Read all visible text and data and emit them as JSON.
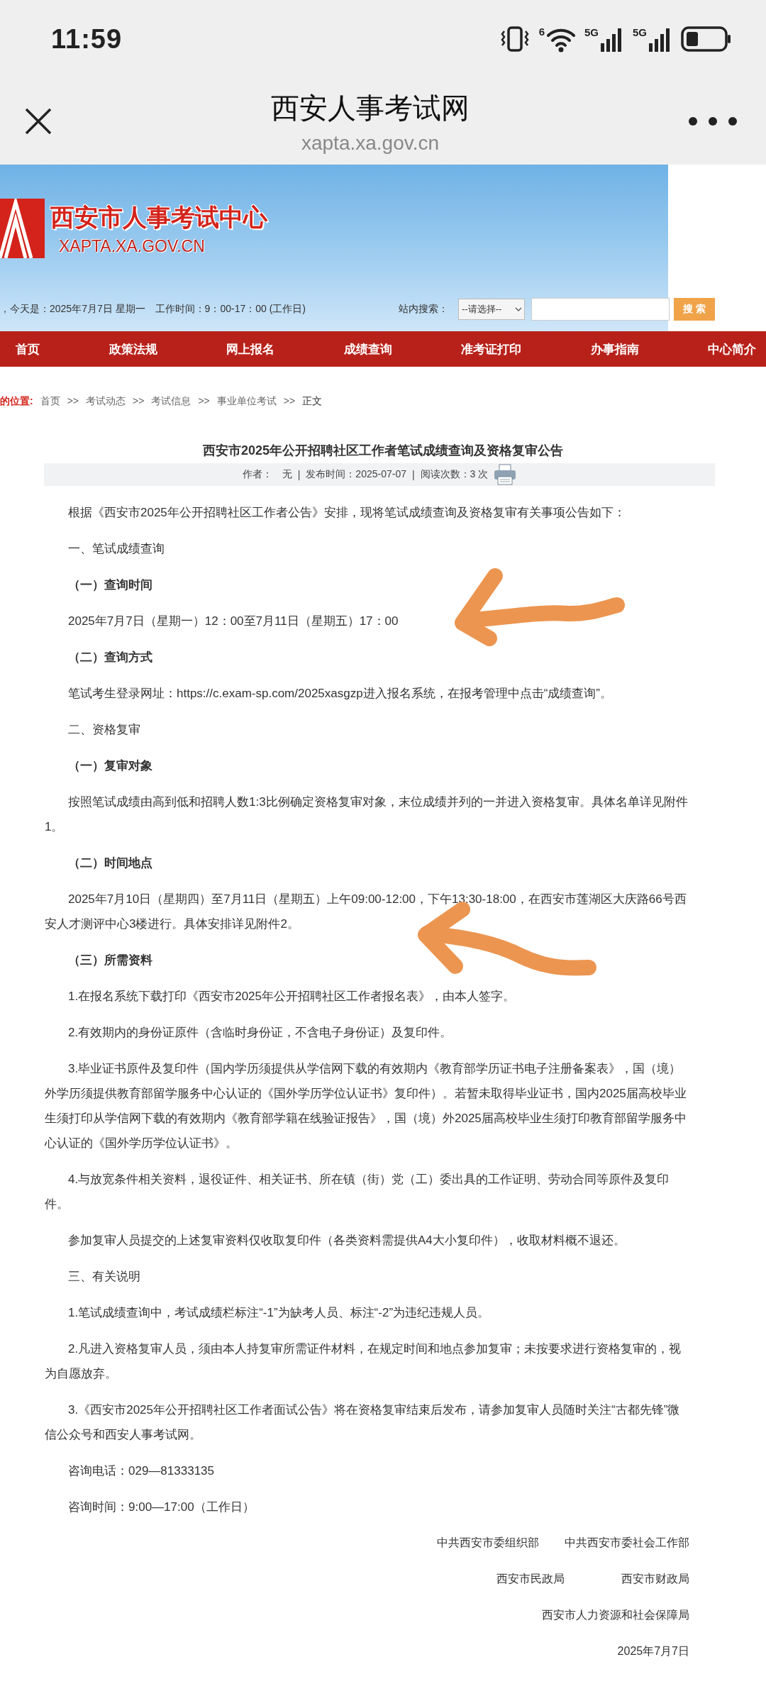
{
  "status_bar": {
    "time": "11:59",
    "wifi_label": "6",
    "network_labels": [
      "5G",
      "5G"
    ]
  },
  "browser": {
    "title": "西安人事考试网",
    "url": "xapta.xa.gov.cn"
  },
  "site_header": {
    "logo_title": "西安市人事考试中心",
    "logo_url": "XAPTA.XA.GOV.CN",
    "date_line": "，今天是：2025年7月7日 星期一　工作时间：9：00-17：00 (工作日)",
    "search_label": "站内搜索：",
    "select_value": "--请选择--",
    "search_button": "搜 索"
  },
  "nav": [
    {
      "label": "首页"
    },
    {
      "label": "政策法规"
    },
    {
      "label": "网上报名"
    },
    {
      "label": "成绩查询"
    },
    {
      "label": "准考证打印"
    },
    {
      "label": "办事指南"
    },
    {
      "label": "中心简介"
    }
  ],
  "breadcrumb": {
    "label": "的位置:",
    "separator": ">>",
    "items": [
      "首页",
      "考试动态",
      "考试信息",
      "事业单位考试",
      "正文"
    ]
  },
  "article": {
    "title": "西安市2025年公开招聘社区工作者笔试成绩查询及资格复审公告",
    "meta": {
      "separator": "|",
      "author_label": "作者：",
      "author": "无",
      "date_label": "发布时间：",
      "date": "2025-07-07",
      "reads_label": "阅读次数：",
      "reads": "3 次"
    },
    "blocks": [
      {
        "kind": "para",
        "text": "根据《西安市2025年公开招聘社区工作者公告》安排，现将笔试成绩查询及资格复审有关事项公告如下："
      },
      {
        "kind": "para",
        "text": "一、笔试成绩查询"
      },
      {
        "kind": "heading",
        "text": "（一）查询时间"
      },
      {
        "kind": "para",
        "text": "2025年7月7日（星期一）12：00至7月11日（星期五）17：00"
      },
      {
        "kind": "heading",
        "text": "（二）查询方式"
      },
      {
        "kind": "para",
        "text": "笔试考生登录网址：https://c.exam-sp.com/2025xasgzp进入报名系统，在报考管理中点击“成绩查询”。"
      },
      {
        "kind": "para",
        "text": "二、资格复审"
      },
      {
        "kind": "heading",
        "text": "（一）复审对象"
      },
      {
        "kind": "para",
        "text": "按照笔试成绩由高到低和招聘人数1:3比例确定资格复审对象，末位成绩并列的一并进入资格复审。具体名单详见附件1。"
      },
      {
        "kind": "heading",
        "text": "（二）时间地点"
      },
      {
        "kind": "para",
        "text": "2025年7月10日（星期四）至7月11日（星期五）上午09:00-12:00，下午13:30-18:00，在西安市莲湖区大庆路66号西安人才测评中心3楼进行。具体安排详见附件2。"
      },
      {
        "kind": "heading",
        "text": "（三）所需资料"
      },
      {
        "kind": "para",
        "text": "1.在报名系统下载打印《西安市2025年公开招聘社区工作者报名表》，由本人签字。"
      },
      {
        "kind": "para",
        "text": "2.有效期内的身份证原件（含临时身份证，不含电子身份证）及复印件。"
      },
      {
        "kind": "para",
        "text": "3.毕业证书原件及复印件（国内学历须提供从学信网下载的有效期内《教育部学历证书电子注册备案表》，国（境）外学历须提供教育部留学服务中心认证的《国外学历学位认证书》复印件）。若暂未取得毕业证书，国内2025届高校毕业生须打印从学信网下载的有效期内《教育部学籍在线验证报告》，国（境）外2025届高校毕业生须打印教育部留学服务中心认证的《国外学历学位认证书》。"
      },
      {
        "kind": "para",
        "text": "4.与放宽条件相关资料，退役证件、相关证书、所在镇（街）党（工）委出具的工作证明、劳动合同等原件及复印件。"
      },
      {
        "kind": "para",
        "text": "参加复审人员提交的上述复审资料仅收取复印件（各类资料需提供A4大小复印件），收取材料概不退还。"
      },
      {
        "kind": "para",
        "text": "三、有关说明"
      },
      {
        "kind": "para",
        "text": "1.笔试成绩查询中，考试成绩栏标注“-1”为缺考人员、标注“-2”为违纪违规人员。"
      },
      {
        "kind": "para",
        "text": "2.凡进入资格复审人员，须由本人持复审所需证件材料，在规定时间和地点参加复审；未按要求进行资格复审的，视为自愿放弃。"
      },
      {
        "kind": "para",
        "text": "3.《西安市2025年公开招聘社区工作者面试公告》将在资格复审结束后发布，请参加复审人员随时关注“古都先锋”微信公众号和西安人事考试网。"
      },
      {
        "kind": "para",
        "text": "咨询电话：029—81333135"
      },
      {
        "kind": "para",
        "text": "咨询时间：9:00—17:00（工作日）"
      }
    ],
    "signatures": [
      [
        "中共西安市委组织部",
        "中共西安市委社会工作部"
      ],
      [
        "西安市民政局",
        "西安市财政局"
      ],
      [
        "西安市人力资源和社会保障局"
      ],
      [
        "2025年7月7日"
      ]
    ]
  }
}
